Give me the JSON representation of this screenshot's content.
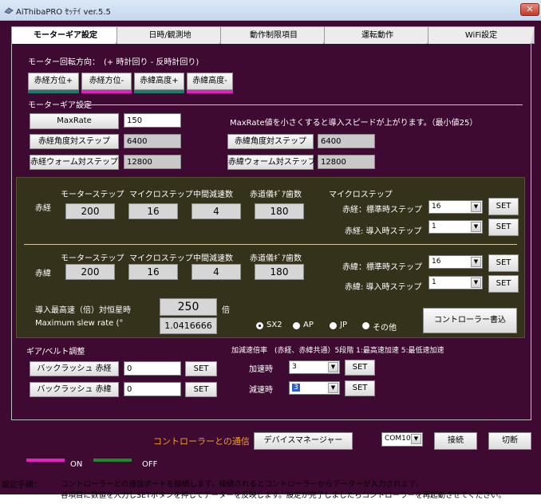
{
  "window": {
    "title": "AiThibaPRO ｾｯﾃｲ ver.5.5",
    "close": "✕"
  },
  "tabs": [
    "モーターギア設定",
    "日時/観測地",
    "動作制限項目",
    "運転動作",
    "WiFi設定"
  ],
  "direction": {
    "label": "モーター回転方向：　(+ 時計回り - 反時計回り)",
    "buttons": [
      {
        "label": "赤経方位+",
        "bar_color": "#1f7a6f"
      },
      {
        "label": "赤経方位-",
        "bar_color": "#e020c0"
      },
      {
        "label": "赤緯高度+",
        "bar_color": "#1f7a6f"
      },
      {
        "label": "赤緯高度-",
        "bar_color": "#e020c0"
      }
    ]
  },
  "motor_gear": {
    "section_label": "モーターギア設定",
    "maxrate_button": "MaxRate",
    "maxrate_value": "150",
    "maxrate_note": "MaxRate値を小さくすると導入スピードが上がります。（最小値25）",
    "ra_angle_label": "赤経角度対ステップ",
    "ra_angle_value": "6400",
    "ra_worm_label": "赤経ウォーム対ステップ",
    "ra_worm_value": "12800",
    "dec_angle_label": "赤緯角度対ステップ",
    "dec_angle_value": "6400",
    "dec_worm_label": "赤緯ウォーム対ステップ",
    "dec_worm_value": "12800"
  },
  "stepper": {
    "headers": [
      "モーターステップ",
      "マイクロステップ",
      "中間減速数",
      "赤道儀ｷﾞｱ歯数"
    ],
    "micro_header": "マイクロステップ",
    "ra": {
      "label": "赤経",
      "values": [
        "200",
        "16",
        "4",
        "180"
      ],
      "standard_label": "赤経：標準時ステップ",
      "standard_value": "16",
      "goto_label": "赤経: 導入時ステップ",
      "goto_value": "1"
    },
    "dec": {
      "label": "赤緯",
      "values": [
        "200",
        "16",
        "4",
        "180"
      ],
      "standard_label": "赤緯：標準時ステップ",
      "standard_value": "16",
      "goto_label": "赤緯: 導入時ステップ",
      "goto_value": "1"
    },
    "set_label": "SET",
    "max_speed_label": "導入最高速（倍）対恒星時",
    "max_speed_value": "250",
    "max_speed_unit": "倍",
    "slew_label": "Maximum slew rate (°",
    "slew_value": "1.0416666",
    "radios": [
      {
        "label": "SX2",
        "checked": true
      },
      {
        "label": "AP",
        "checked": false
      },
      {
        "label": "JP",
        "checked": false
      },
      {
        "label": "その他",
        "checked": false
      }
    ],
    "write_button": "コントローラー書込"
  },
  "gear_belt": {
    "label": "ギア/ベルト調整",
    "ra_backlash_label": "バックラッシュ 赤経",
    "ra_backlash_value": "0",
    "dec_backlash_label": "バックラッシュ 赤緯",
    "dec_backlash_value": "0",
    "set_label": "SET"
  },
  "accel": {
    "label": "加減速倍率　(赤経、赤緯共通）5段階 1:最高速加速 5:最低速加速",
    "accel_label": "加速時",
    "accel_value": "3",
    "decel_label": "減速時",
    "decel_value": "3",
    "set_label": "SET"
  },
  "comm": {
    "label": "コントローラーとの通信",
    "label_color": "#f0a020",
    "device_manager": "デバイスマネージャー",
    "port_value": "COM10",
    "connect": "接続",
    "disconnect": "切断"
  },
  "legend": {
    "on": "ON",
    "off": "OFF",
    "on_color": "#e020c0",
    "off_color": "#1f8a2a"
  },
  "instructions": {
    "prefix": "設定手順：",
    "line1": "コントローラーとの通信ポートを接続します。接続されるとコントローラーからデーターが入力されます。",
    "line2": "各項目に数値を入力しSETボタンを押してデーターを反映します。設定が完了しましたらコントローラーを再起動させてください。"
  }
}
